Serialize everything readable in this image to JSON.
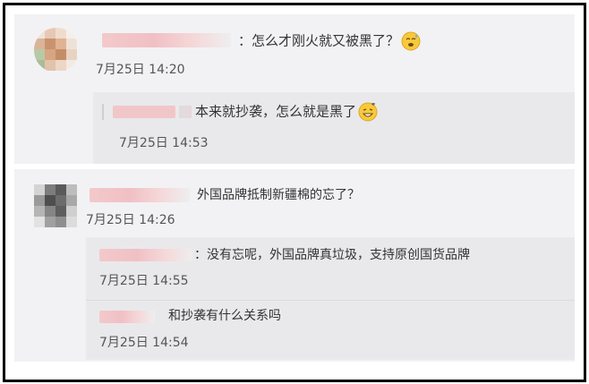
{
  "comments": [
    {
      "text": "：怎么才刚火就又被黑了？",
      "emoji": "sweat-smile-emoji",
      "time": "7月25日 14:20",
      "replies": [
        {
          "text": "本来就抄袭，怎么就是黑了",
          "emoji": "grin-sweat-emoji",
          "time": "7月25日 14:53"
        }
      ]
    },
    {
      "text": "外国品牌抵制新疆棉的忘了？",
      "time": "7月25日 14:26",
      "replies": [
        {
          "text": "：没有忘呢，外国品牌真垃圾，支持原创国货品牌",
          "time": "7月25日 14:55"
        },
        {
          "text": "和抄袭有什么关系吗",
          "time": "7月25日 14:54"
        }
      ]
    }
  ],
  "colors": {
    "card_bg": "#f2f2f4",
    "reply_bg": "#e9e9ec",
    "blur_name": "#f0c0c4",
    "frame": "#000000"
  }
}
